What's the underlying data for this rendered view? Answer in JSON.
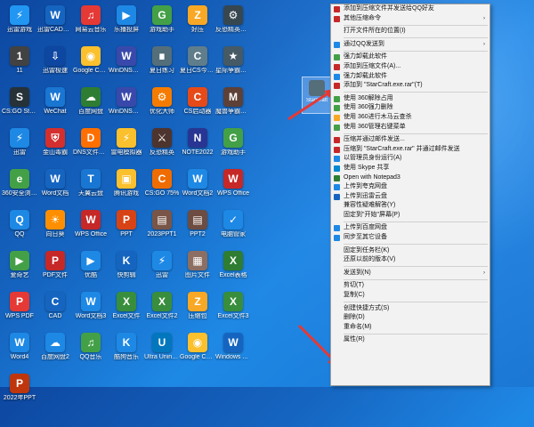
{
  "desktop_icons": [
    {
      "label": "迅雷游戏",
      "color": "#2196f3",
      "glyph": "⚡"
    },
    {
      "label": "迅雷CAD看图王电脑版",
      "color": "#1565c0",
      "glyph": "W"
    },
    {
      "label": "网易云音乐",
      "color": "#e53935",
      "glyph": "♫"
    },
    {
      "label": "乐播投屏",
      "color": "#1e88e5",
      "glyph": "▶"
    },
    {
      "label": "游戏助手",
      "color": "#43a047",
      "glyph": "G"
    },
    {
      "label": "好压",
      "color": "#f9a825",
      "glyph": "Z"
    },
    {
      "label": "反恐精英完美助手",
      "color": "#37474f",
      "glyph": "⚙"
    },
    {
      "label": "11",
      "color": "#424242",
      "glyph": "1"
    },
    {
      "label": "迅雷极速",
      "color": "#0d47a1",
      "glyph": "⇩"
    },
    {
      "label": "Google Chrome",
      "color": "#fbc02d",
      "glyph": "◉"
    },
    {
      "label": "WinDNS解析12",
      "color": "#3949ab",
      "glyph": "W"
    },
    {
      "label": "夏日练习",
      "color": "#546e7a",
      "glyph": "∎"
    },
    {
      "label": "夏日CS今年9月01日",
      "color": "#607d8b",
      "glyph": "C"
    },
    {
      "label": "星际争霸完美助手",
      "color": "#455a64",
      "glyph": "★"
    },
    {
      "label": "CS:GO Steam",
      "color": "#263238",
      "glyph": "S"
    },
    {
      "label": "WeChat",
      "color": "#1976d2",
      "glyph": "W"
    },
    {
      "label": "百度网盘",
      "color": "#2e7d32",
      "glyph": "☁"
    },
    {
      "label": "WinDNS解析12",
      "color": "#3949ab",
      "glyph": "W"
    },
    {
      "label": "优化大师",
      "color": "#f57c00",
      "glyph": "⚙"
    },
    {
      "label": "CS启动器",
      "color": "#e64a19",
      "glyph": "C"
    },
    {
      "label": "魔兽争霸助手",
      "color": "#5d4037",
      "glyph": "M"
    },
    {
      "label": "迅雷",
      "color": "#1e88e5",
      "glyph": "⚡"
    },
    {
      "label": "金山毒霸",
      "color": "#d32f2f",
      "glyph": "⛨"
    },
    {
      "label": "DNS文件服务器",
      "color": "#ff6f00",
      "glyph": "D"
    },
    {
      "label": "雷电模拟器",
      "color": "#fbc02d",
      "glyph": "⚡"
    },
    {
      "label": "反恐精英",
      "color": "#4e342e",
      "glyph": "⚔"
    },
    {
      "label": "NOTE2022",
      "color": "#283593",
      "glyph": "N"
    },
    {
      "label": "游戏助手",
      "color": "#43a047",
      "glyph": "G"
    },
    {
      "label": "360安全浏览器",
      "color": "#43a047",
      "glyph": "e"
    },
    {
      "label": "Word文档",
      "color": "#1565c0",
      "glyph": "W"
    },
    {
      "label": "天翼云盘",
      "color": "#1976d2",
      "glyph": "T"
    },
    {
      "label": "腾讯游戏",
      "color": "#fbc02d",
      "glyph": "▣"
    },
    {
      "label": "CS:GO 75%",
      "color": "#ef6c00",
      "glyph": "C"
    },
    {
      "label": "Word文档2",
      "color": "#1e88e5",
      "glyph": "W"
    },
    {
      "label": "WPS Office",
      "color": "#c62828",
      "glyph": "W"
    },
    {
      "label": "QQ",
      "color": "#1e88e5",
      "glyph": "Q"
    },
    {
      "label": "向日葵",
      "color": "#ff8f00",
      "glyph": "☀"
    },
    {
      "label": "WPS Office",
      "color": "#c62828",
      "glyph": "W"
    },
    {
      "label": "PPT",
      "color": "#d84315",
      "glyph": "P"
    },
    {
      "label": "2023PPT1",
      "color": "#795548",
      "glyph": "▤"
    },
    {
      "label": "PPT2",
      "color": "#6d4c41",
      "glyph": "▤"
    },
    {
      "label": "电脑管家",
      "color": "#1e88e5",
      "glyph": "✓"
    },
    {
      "label": "爱奇艺",
      "color": "#43a047",
      "glyph": "▶"
    },
    {
      "label": "PDF文件",
      "color": "#c62828",
      "glyph": "P"
    },
    {
      "label": "优酷",
      "color": "#1e88e5",
      "glyph": "▶"
    },
    {
      "label": "快剪辑",
      "color": "#1565c0",
      "glyph": "K"
    },
    {
      "label": "迅雷",
      "color": "#1e88e5",
      "glyph": "⚡"
    },
    {
      "label": "图片文件",
      "color": "#8d6e63",
      "glyph": "▦"
    },
    {
      "label": "Excel表格",
      "color": "#2e7d32",
      "glyph": "X"
    },
    {
      "label": "WPS PDF",
      "color": "#e53935",
      "glyph": "P"
    },
    {
      "label": "CAD",
      "color": "#1565c0",
      "glyph": "C"
    },
    {
      "label": "Word文档3",
      "color": "#1e88e5",
      "glyph": "W"
    },
    {
      "label": "Excel文件",
      "color": "#388e3c",
      "glyph": "X"
    },
    {
      "label": "Excel文件2",
      "color": "#388e3c",
      "glyph": "X"
    },
    {
      "label": "压缩包",
      "color": "#f9a825",
      "glyph": "Z"
    },
    {
      "label": "Excel文件3",
      "color": "#388e3c",
      "glyph": "X"
    },
    {
      "label": "Word4",
      "color": "#1e88e5",
      "glyph": "W"
    },
    {
      "label": "百度网盘2",
      "color": "#1e88e5",
      "glyph": "☁"
    },
    {
      "label": "QQ音乐",
      "color": "#43a047",
      "glyph": "♫"
    },
    {
      "label": "酷狗音乐",
      "color": "#1e88e5",
      "glyph": "K"
    },
    {
      "label": "Ultra Uninstaller",
      "color": "#0277bd",
      "glyph": "U"
    },
    {
      "label": "Google Chrome",
      "color": "#fbc02d",
      "glyph": "◉"
    },
    {
      "label": "Windows AIK",
      "color": "#1565c0",
      "glyph": "W"
    },
    {
      "label": "2022年PPT",
      "color": "#bf360c",
      "glyph": "P"
    }
  ],
  "selected_icon": {
    "label": "StarCraft"
  },
  "context_menu": {
    "items": [
      {
        "label": "添加到压缩文件并发送给QQ好友",
        "icon": "archive-icon",
        "color": "#c62828"
      },
      {
        "label": "其他压缩命令",
        "icon": "archive-icon",
        "color": "#c62828",
        "submenu": true
      },
      {
        "sep": true
      },
      {
        "label": "打开文件所在的位置(I)"
      },
      {
        "sep": true
      },
      {
        "label": "通过QQ发送到",
        "icon": "qq-icon",
        "color": "#1e88e5",
        "submenu": true
      },
      {
        "sep": true
      },
      {
        "label": "强力卸载此软件",
        "icon": "uninstall-icon",
        "color": "#43a047"
      },
      {
        "label": "添加到压缩文件(A)...",
        "icon": "archive-icon",
        "color": "#c62828"
      },
      {
        "label": "强力卸载此软件",
        "icon": "uninstall-icon",
        "color": "#1e88e5"
      },
      {
        "label": "添加到 \"StarCraft.exe.rar\"(T)",
        "icon": "archive-icon",
        "color": "#c62828"
      },
      {
        "sep": true
      },
      {
        "label": "使用 360解除占用",
        "icon": "360-icon",
        "color": "#43a047"
      },
      {
        "label": "使用 360强力删除",
        "icon": "360-icon",
        "color": "#43a047"
      },
      {
        "label": "使用 360进行木马云查杀",
        "icon": "360-icon",
        "color": "#f9a825"
      },
      {
        "label": "使用 360管理右键菜单",
        "icon": "360-icon",
        "color": "#43a047"
      },
      {
        "sep": true
      },
      {
        "label": "压缩并通过邮件发送...",
        "icon": "archive-icon",
        "color": "#c62828"
      },
      {
        "label": "压缩到 \"StarCraft.exe.rar\" 并通过邮件发送",
        "icon": "archive-icon",
        "color": "#c62828"
      },
      {
        "label": "以管理员身份运行(A)",
        "icon": "shield-icon",
        "color": "#1e88e5"
      },
      {
        "label": "使用 Skype 共享",
        "icon": "skype-icon",
        "color": "#0288d1"
      },
      {
        "label": "Open with Notepad3",
        "icon": "notepad-icon",
        "color": "#2e7d32"
      },
      {
        "label": "上传到夸克网盘",
        "icon": "cloud-icon",
        "color": "#1e88e5"
      },
      {
        "label": "上传到迅雷云盘",
        "icon": "cloud-icon",
        "color": "#1565c0"
      },
      {
        "label": "兼容性疑难解答(Y)"
      },
      {
        "label": "固定到\"开始\"屏幕(P)"
      },
      {
        "sep": true
      },
      {
        "label": "上传到百度网盘",
        "icon": "cloud-icon",
        "color": "#1e88e5"
      },
      {
        "label": "同步至其它设备",
        "icon": "sync-icon",
        "color": "#1e88e5"
      },
      {
        "sep": true
      },
      {
        "label": "固定到任务栏(K)"
      },
      {
        "label": "还原以前的版本(V)"
      },
      {
        "sep": true
      },
      {
        "label": "发送到(N)",
        "submenu": true
      },
      {
        "sep": true
      },
      {
        "label": "剪切(T)"
      },
      {
        "label": "复制(C)"
      },
      {
        "sep": true
      },
      {
        "label": "创建快捷方式(S)"
      },
      {
        "label": "删除(D)"
      },
      {
        "label": "重命名(M)"
      },
      {
        "sep": true
      },
      {
        "label": "属性(R)"
      }
    ]
  }
}
